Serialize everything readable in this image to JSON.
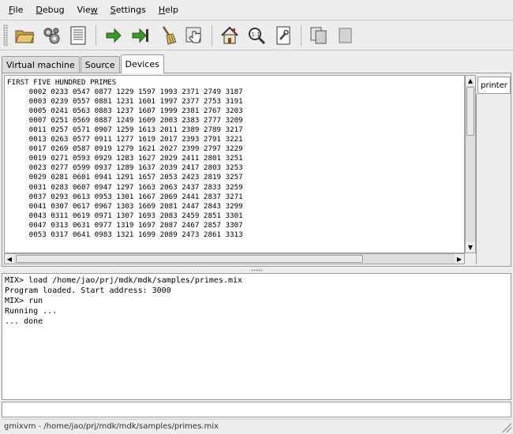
{
  "menu": [
    "File",
    "Debug",
    "View",
    "Settings",
    "Help"
  ],
  "menu_mnemonics": [
    "F",
    "D",
    "V",
    "S",
    "H"
  ],
  "toolbar_icons": [
    "open-folder-icon",
    "gears-icon",
    "document-list-icon",
    "arrow-right-icon",
    "arrow-right-end-icon",
    "broom-icon",
    "hand-pointer-icon",
    "home-icon",
    "zoom-icon",
    "wrench-document-icon",
    "copy-pages-icon",
    "page-icon"
  ],
  "tabs": [
    "Virtual machine",
    "Source",
    "Devices"
  ],
  "active_tab": "Devices",
  "printer_tab": "printer",
  "printer_output": [
    "FIRST FIVE HUNDRED PRIMES",
    "     0002 0233 0547 0877 1229 1597 1993 2371 2749 3187",
    "     0003 0239 0557 0881 1231 1601 1997 2377 2753 3191",
    "     0005 0241 0563 0883 1237 1607 1999 2381 2767 3203",
    "     0007 0251 0569 0887 1249 1609 2003 2383 2777 3209",
    "     0011 0257 0571 0907 1259 1613 2011 2389 2789 3217",
    "     0013 0263 0577 0911 1277 1619 2017 2393 2791 3221",
    "     0017 0269 0587 0919 1279 1621 2027 2399 2797 3229",
    "     0019 0271 0593 0929 1283 1627 2029 2411 2801 3251",
    "     0023 0277 0599 0937 1289 1637 2039 2417 2803 3253",
    "     0029 0281 0601 0941 1291 1657 2053 2423 2819 3257",
    "     0031 0283 0607 0947 1297 1663 2063 2437 2833 3259",
    "     0037 0293 0613 0953 1301 1667 2069 2441 2837 3271",
    "     0041 0307 0617 0967 1303 1669 2081 2447 2843 3299",
    "     0043 0311 0619 0971 1307 1693 2083 2459 2851 3301",
    "     0047 0313 0631 0977 1319 1697 2087 2467 2857 3307",
    "     0053 0317 0641 0983 1321 1699 2089 2473 2861 3313"
  ],
  "console_lines": [
    "MIX> load /home/jao/prj/mdk/mdk/samples/primes.mix",
    "Program loaded. Start address: 3000",
    "MIX> run",
    "Running ...",
    "... done"
  ],
  "command_input": {
    "value": ""
  },
  "status": "gmixvm - /home/jao/prj/mdk/mdk/samples/primes.mix"
}
